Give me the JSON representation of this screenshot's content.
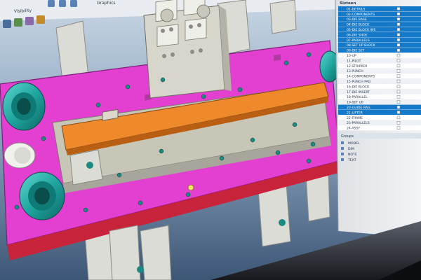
{
  "colors": {
    "viewport_top": "#c9d6e3",
    "viewport_bottom": "#3c5675",
    "plate": "#e33fd0",
    "plate_edge": "#c7243c",
    "base": "#c8c6b6",
    "rail": "#ee8a2b",
    "cylinder": "#1fa6a0",
    "block": "#e2e2dc",
    "panel_bg": "#f2f4f7",
    "panel_select": "#1479c8"
  },
  "toolbar": {
    "visibility_label": "Visibility",
    "graphics_label": "Graphics"
  },
  "panel": {
    "title": "Sixteen",
    "group_header": "Groups",
    "tree_items": [
      {
        "label": "01-DETAILS",
        "selected": true
      },
      {
        "label": "02-COMPONENTS",
        "selected": true
      },
      {
        "label": "03-DIE BASE",
        "selected": true
      },
      {
        "label": "04-DIE BLOCK",
        "selected": true
      },
      {
        "label": "05-DIE BLOCK INS",
        "selected": true
      },
      {
        "label": "06-DIE SHOE",
        "selected": true
      },
      {
        "label": "07-PARALLELS",
        "selected": true
      },
      {
        "label": "08-SET UP BLOCK",
        "selected": true
      },
      {
        "label": "09-DIE SET",
        "selected": true
      },
      {
        "label": "10-UP",
        "selected": false
      },
      {
        "label": "11-PILOT",
        "selected": false
      },
      {
        "label": "12-STRIPPER",
        "selected": false
      },
      {
        "label": "13-PUNCH",
        "selected": false
      },
      {
        "label": "14-COMPONENTS",
        "selected": false
      },
      {
        "label": "15-PUNCH PAD",
        "selected": false
      },
      {
        "label": "16-DIE BLOCK",
        "selected": false
      },
      {
        "label": "17-DIE INSERT",
        "selected": false
      },
      {
        "label": "18-PARALLEL",
        "selected": false
      },
      {
        "label": "19-SET UP",
        "selected": false
      },
      {
        "label": "20-GUIDE RAIL",
        "selected": true
      },
      {
        "label": "21-LIFTER",
        "selected": true
      },
      {
        "label": "22-FRAME",
        "selected": false
      },
      {
        "label": "23-PARALLELS",
        "selected": false
      },
      {
        "label": "24-ASSY",
        "selected": false
      }
    ],
    "lower_list": [
      {
        "label": "MODEL"
      },
      {
        "label": "DIM"
      },
      {
        "label": "NOTE"
      },
      {
        "label": "TEXT"
      }
    ]
  }
}
